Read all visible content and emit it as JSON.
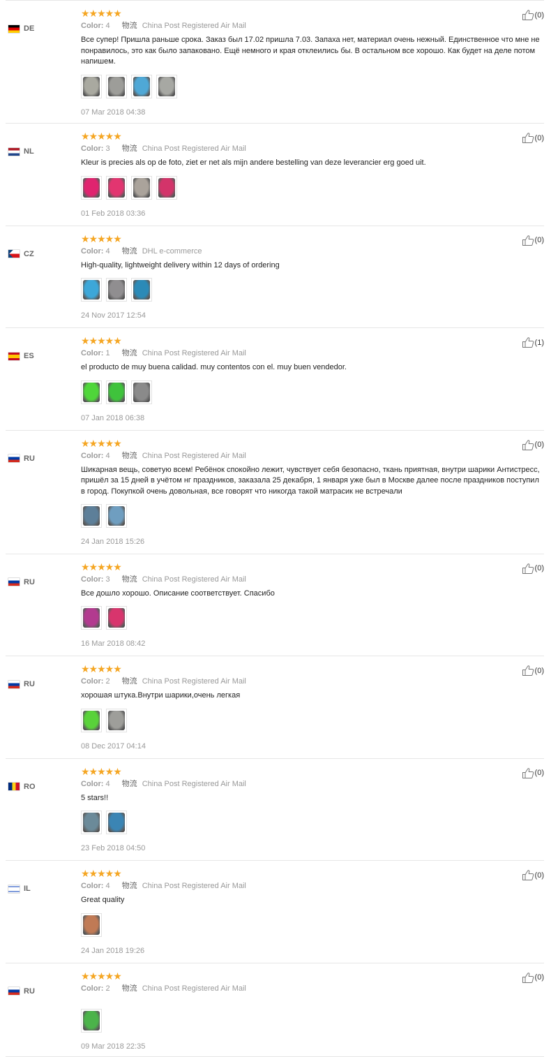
{
  "reviews": [
    {
      "country": "DE",
      "flag": [
        "#000000",
        "#dd0000",
        "#ffce00"
      ],
      "flag_dir": "h",
      "stars": "★★★★★",
      "color_label": "Color:",
      "color_value": "4",
      "logistics_label": "物流",
      "logistics_value": "China Post Registered Air Mail",
      "text": "Все супер! Пришла раньше срока. Заказ был 17.02 пришла 7.03. Запаха нет, материал очень нежный. Единственное что мне не понравилось, это как было запаковано. Ещё немного и края отклеились бы. В остальном все хорошо. Как будет на деле потом напишем.",
      "photos": [
        "#a9a9a0",
        "#9d9d99",
        "#4fa8d6",
        "#a7a8a3"
      ],
      "date": "07 Mar 2018 04:38",
      "useful": "(0)"
    },
    {
      "country": "NL",
      "flag": [
        "#ae1c28",
        "#ffffff",
        "#21468b"
      ],
      "flag_dir": "h",
      "stars": "★★★★★",
      "color_label": "Color:",
      "color_value": "3",
      "logistics_label": "物流",
      "logistics_value": "China Post Registered Air Mail",
      "text": "Kleur is precies als op de foto, ziet er net als mijn andere bestelling van deze leverancier erg goed uit.",
      "photos": [
        "#e0246f",
        "#e23570",
        "#aaa39b",
        "#d3346a"
      ],
      "date": "01 Feb 2018 03:36",
      "useful": "(0)"
    },
    {
      "country": "CZ",
      "flag": [
        "#ffffff",
        "#d7141a",
        "#11457e"
      ],
      "flag_dir": "cz",
      "stars": "★★★★★",
      "color_label": "Color:",
      "color_value": "4",
      "logistics_label": "物流",
      "logistics_value": "DHL e-commerce",
      "text": "High-quality, lightweight delivery within 12 days of ordering",
      "photos": [
        "#3da7d8",
        "#908e90",
        "#2b8ab7"
      ],
      "date": "24 Nov 2017 12:54",
      "useful": "(0)"
    },
    {
      "country": "ES",
      "flag": [
        "#c60b1e",
        "#ffc400",
        "#c60b1e"
      ],
      "flag_dir": "es",
      "stars": "★★★★★",
      "color_label": "Color:",
      "color_value": "1",
      "logistics_label": "物流",
      "logistics_value": "China Post Registered Air Mail",
      "text": "el producto de muy buena calidad. muy contentos con el. muy buen vendedor.",
      "photos": [
        "#4fd63a",
        "#3fc33c",
        "#8a8a8a"
      ],
      "date": "07 Jan 2018 06:38",
      "useful": "(1)"
    },
    {
      "country": "RU",
      "flag": [
        "#ffffff",
        "#0039a6",
        "#d52b1e"
      ],
      "flag_dir": "h",
      "stars": "★★★★★",
      "color_label": "Color:",
      "color_value": "4",
      "logistics_label": "物流",
      "logistics_value": "China Post Registered Air Mail",
      "text": "Шикарная вещь, советую всем! Ребёнок спокойно лежит, чувствует себя безопасно, ткань приятная, внутри шарики Антистресс, пришёл за 15 дней в учётом нг праздников, заказала 25 декабря, 1 января уже был в Москве далее после праздников поступил в город. Покупкой очень довольная, все говорят что никогда такой матрасик не встречали",
      "photos": [
        "#5d7f99",
        "#6f9ec0"
      ],
      "date": "24 Jan 2018 15:26",
      "useful": "(0)"
    },
    {
      "country": "RU",
      "flag": [
        "#ffffff",
        "#0039a6",
        "#d52b1e"
      ],
      "flag_dir": "h",
      "stars": "★★★★★",
      "color_label": "Color:",
      "color_value": "3",
      "logistics_label": "物流",
      "logistics_value": "China Post Registered Air Mail",
      "text": "Все дошло хорошо. Описание соответствует. Спасибо",
      "photos": [
        "#b23a8f",
        "#d8356d"
      ],
      "date": "16 Mar 2018 08:42",
      "useful": "(0)"
    },
    {
      "country": "RU",
      "flag": [
        "#ffffff",
        "#0039a6",
        "#d52b1e"
      ],
      "flag_dir": "h",
      "stars": "★★★★★",
      "color_label": "Color:",
      "color_value": "2",
      "logistics_label": "物流",
      "logistics_value": "China Post Registered Air Mail",
      "text": "хорошая штука.Внутри шарики,очень легкая",
      "photos": [
        "#59d23a",
        "#9e9e9a"
      ],
      "date": "08 Dec 2017 04:14",
      "useful": "(0)"
    },
    {
      "country": "RO",
      "flag": [
        "#002b7f",
        "#fcd116",
        "#ce1126"
      ],
      "flag_dir": "v",
      "stars": "★★★★★",
      "color_label": "Color:",
      "color_value": "4",
      "logistics_label": "物流",
      "logistics_value": "China Post Registered Air Mail",
      "text": "5 stars!!",
      "photos": [
        "#6b8a99",
        "#3b85b4"
      ],
      "date": "23 Feb 2018 04:50",
      "useful": "(0)"
    },
    {
      "country": "IL",
      "flag": [
        "#ffffff",
        "#0038b8",
        "#ffffff"
      ],
      "flag_dir": "il",
      "stars": "★★★★★",
      "color_label": "Color:",
      "color_value": "4",
      "logistics_label": "物流",
      "logistics_value": "China Post Registered Air Mail",
      "text": "Great quality",
      "photos": [
        "#c07a55"
      ],
      "date": "24 Jan 2018 19:26",
      "useful": "(0)"
    },
    {
      "country": "RU",
      "flag": [
        "#ffffff",
        "#0039a6",
        "#d52b1e"
      ],
      "flag_dir": "h",
      "stars": "★★★★★",
      "color_label": "Color:",
      "color_value": "2",
      "logistics_label": "物流",
      "logistics_value": "China Post Registered Air Mail",
      "text": "",
      "photos": [
        "#4bb34a"
      ],
      "date": "09 Mar 2018 22:35",
      "useful": "(0)"
    }
  ]
}
